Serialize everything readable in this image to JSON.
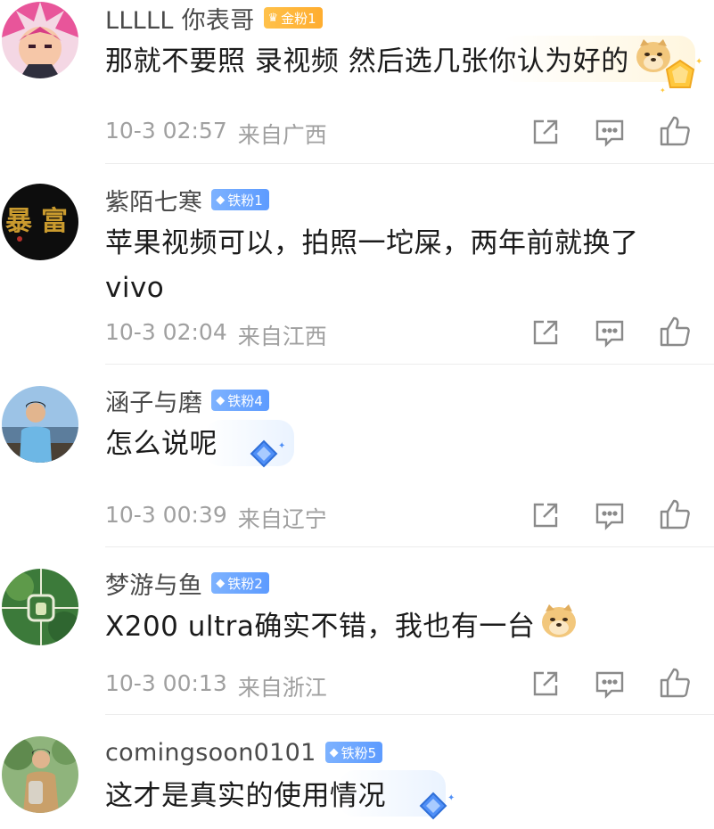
{
  "comments": [
    {
      "username": "LLLLL 你表哥",
      "badge": {
        "label": "金粉1",
        "tier": "gold"
      },
      "text": "那就不要照 录视频 然后选几张你认为好的",
      "time": "10-3 02:57",
      "location": "来自广西",
      "avatar_icon": "anime-character-avatar",
      "emoji": "doge-emoji"
    },
    {
      "username": "紫陌七寒",
      "badge": {
        "label": "铁粉1",
        "tier": "iron"
      },
      "text": "苹果视频可以，拍照一坨屎，两年前就换了vivo",
      "time": "10-3 02:04",
      "location": "来自江西",
      "avatar_icon": "calligraphy-avatar"
    },
    {
      "username": "涵子与磨",
      "badge": {
        "label": "铁粉4",
        "tier": "iron"
      },
      "text": "怎么说呢",
      "time": "10-3 00:39",
      "location": "来自辽宁",
      "avatar_icon": "person-seaside-avatar"
    },
    {
      "username": "梦游与鱼",
      "badge": {
        "label": "铁粉2",
        "tier": "iron"
      },
      "text": "X200 ultra确实不错，我也有一台",
      "time": "10-3 00:13",
      "location": "来自浙江",
      "avatar_icon": "green-pattern-avatar",
      "emoji": "doge-emoji"
    },
    {
      "username": "comingsoon0101",
      "badge": {
        "label": "铁粉5",
        "tier": "iron"
      },
      "text": "这才是真实的使用情况",
      "avatar_icon": "person-outdoor-avatar"
    }
  ],
  "actions": {
    "share_icon": "share-icon",
    "reply_icon": "comment-icon",
    "like_icon": "thumbs-up-icon"
  },
  "colors": {
    "gold_badge": "#ffb43a",
    "iron_badge": "#6aa6ff",
    "meta_text": "#a0a0a0",
    "body_text": "#1b1b1b",
    "name_text": "#4a4a4a"
  }
}
